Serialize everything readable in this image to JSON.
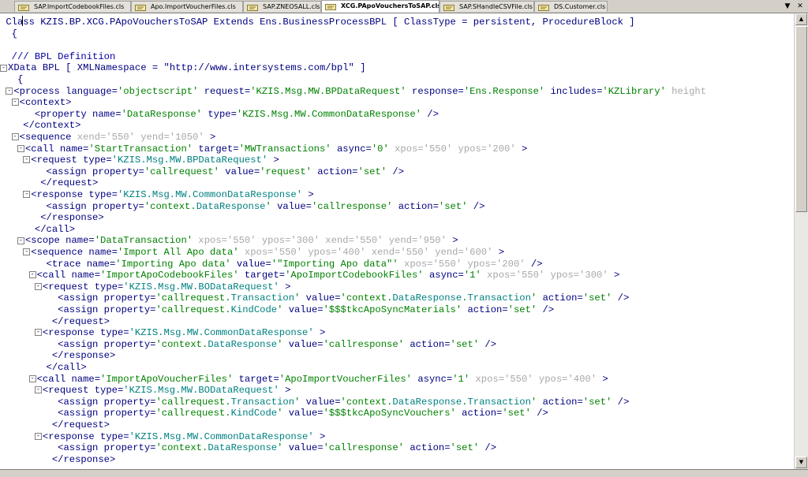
{
  "tabs": [
    {
      "label": "SAP.ImportCodebookFiles.cls",
      "active": false
    },
    {
      "label": "Apo.ImportVoucherFiles.cls",
      "active": false
    },
    {
      "label": "SAP.ZNEOSALL.cls",
      "active": false
    },
    {
      "label": "XCG.PApoVouchersToSAP.cls",
      "active": true
    },
    {
      "label": "SAP.SHandleCSVFile.cls",
      "active": false
    },
    {
      "label": "DS.Customer.cls",
      "active": false
    }
  ],
  "tab_controls": {
    "menu_icon": "chevron-down-icon",
    "close_icon": "close-icon"
  },
  "colors": {
    "tag": "#000080",
    "string": "#008000",
    "ident": "#0000a0",
    "grey_attr": "#a8a8a8",
    "class_ref": "#008080"
  },
  "code_lines": [
    {
      "fold": "",
      "indent": "",
      "tokens": [
        [
          "k",
          "Class "
        ],
        [
          "p",
          "KZIS.BP.XCG.PApoVouchersToSAP "
        ],
        [
          "k",
          "Extends "
        ],
        [
          "p",
          "Ens.BusinessProcessBPL "
        ],
        [
          "k",
          "[ "
        ],
        [
          "p",
          "ClassType "
        ],
        [
          "k",
          "= "
        ],
        [
          "p",
          "persistent, ProcedureBlock "
        ],
        [
          "k",
          "]"
        ]
      ]
    },
    {
      "fold": "",
      "indent": " ",
      "tokens": [
        [
          "k",
          "{"
        ]
      ]
    },
    {
      "fold": "",
      "indent": "",
      "tokens": []
    },
    {
      "fold": "",
      "indent": " ",
      "tokens": [
        [
          "b",
          "/// BPL Definition"
        ]
      ]
    },
    {
      "fold": "-",
      "indent": "",
      "tokens": [
        [
          "k",
          "XData "
        ],
        [
          "p",
          "BPL "
        ],
        [
          "k",
          "[ "
        ],
        [
          "p",
          "XMLNamespace "
        ],
        [
          "k",
          "= "
        ],
        [
          "p",
          "\"http://www.intersystems.com/bpl\" "
        ],
        [
          "k",
          "]"
        ]
      ]
    },
    {
      "fold": "",
      "indent": "  ",
      "tokens": [
        [
          "k",
          "{"
        ]
      ]
    },
    {
      "fold": "-",
      "indent": " ",
      "tokens": [
        [
          "p",
          "<process "
        ],
        [
          "p",
          "language="
        ],
        [
          "s",
          "'objectscript' "
        ],
        [
          "p",
          "request="
        ],
        [
          "s",
          "'KZIS.Msg.MW.BPDataRequest' "
        ],
        [
          "p",
          "response="
        ],
        [
          "s",
          "'Ens.Response' "
        ],
        [
          "p",
          "includes="
        ],
        [
          "s",
          "'KZLibrary' "
        ],
        [
          "g",
          "height"
        ]
      ]
    },
    {
      "fold": "-",
      "indent": "  ",
      "tokens": [
        [
          "p",
          "<context>"
        ]
      ]
    },
    {
      "fold": "",
      "indent": "     ",
      "tokens": [
        [
          "p",
          "<property "
        ],
        [
          "p",
          "name="
        ],
        [
          "s",
          "'DataResponse' "
        ],
        [
          "p",
          "type="
        ],
        [
          "s",
          "'KZIS.Msg.MW.CommonDataResponse' "
        ],
        [
          "p",
          "/>"
        ]
      ]
    },
    {
      "fold": "",
      "indent": "   ",
      "tokens": [
        [
          "p",
          "</context>"
        ]
      ]
    },
    {
      "fold": "-",
      "indent": "  ",
      "tokens": [
        [
          "p",
          "<sequence "
        ],
        [
          "g",
          "xend='550' yend='1050' "
        ],
        [
          "p",
          ">"
        ]
      ]
    },
    {
      "fold": "-",
      "indent": "   ",
      "tokens": [
        [
          "p",
          "<call "
        ],
        [
          "p",
          "name="
        ],
        [
          "s",
          "'StartTransaction' "
        ],
        [
          "p",
          "target="
        ],
        [
          "s",
          "'MWTransactions' "
        ],
        [
          "p",
          "async="
        ],
        [
          "s",
          "'0' "
        ],
        [
          "g",
          "xpos='550' ypos='200' "
        ],
        [
          "p",
          ">"
        ]
      ]
    },
    {
      "fold": "-",
      "indent": "    ",
      "tokens": [
        [
          "p",
          "<request "
        ],
        [
          "p",
          "type="
        ],
        [
          "c",
          "'KZIS.Msg.MW.BPDataRequest' "
        ],
        [
          "p",
          ">"
        ]
      ]
    },
    {
      "fold": "",
      "indent": "       ",
      "tokens": [
        [
          "p",
          "<assign "
        ],
        [
          "p",
          "property="
        ],
        [
          "s",
          "'callrequest' "
        ],
        [
          "p",
          "value="
        ],
        [
          "s",
          "'request' "
        ],
        [
          "p",
          "action="
        ],
        [
          "s",
          "'set' "
        ],
        [
          "p",
          "/>"
        ]
      ]
    },
    {
      "fold": "",
      "indent": "      ",
      "tokens": [
        [
          "p",
          "</request>"
        ]
      ]
    },
    {
      "fold": "-",
      "indent": "    ",
      "tokens": [
        [
          "p",
          "<response "
        ],
        [
          "p",
          "type="
        ],
        [
          "c",
          "'KZIS.Msg.MW.CommonDataResponse' "
        ],
        [
          "p",
          ">"
        ]
      ]
    },
    {
      "fold": "",
      "indent": "       ",
      "tokens": [
        [
          "p",
          "<assign "
        ],
        [
          "p",
          "property="
        ],
        [
          "s",
          "'context."
        ],
        [
          "c",
          "DataResponse"
        ],
        [
          "s",
          "' "
        ],
        [
          "p",
          "value="
        ],
        [
          "s",
          "'callresponse' "
        ],
        [
          "p",
          "action="
        ],
        [
          "s",
          "'set' "
        ],
        [
          "p",
          "/>"
        ]
      ]
    },
    {
      "fold": "",
      "indent": "      ",
      "tokens": [
        [
          "p",
          "</response>"
        ]
      ]
    },
    {
      "fold": "",
      "indent": "     ",
      "tokens": [
        [
          "p",
          "</call>"
        ]
      ]
    },
    {
      "fold": "-",
      "indent": "   ",
      "tokens": [
        [
          "p",
          "<scope "
        ],
        [
          "p",
          "name="
        ],
        [
          "s",
          "'DataTransaction' "
        ],
        [
          "g",
          "xpos='550' ypos='300' xend='550' yend='950' "
        ],
        [
          "p",
          ">"
        ]
      ]
    },
    {
      "fold": "-",
      "indent": "    ",
      "tokens": [
        [
          "p",
          "<sequence "
        ],
        [
          "p",
          "name="
        ],
        [
          "s",
          "'Import All Apo data' "
        ],
        [
          "g",
          "xpos='550' ypos='400' xend='550' yend='600' "
        ],
        [
          "p",
          ">"
        ]
      ]
    },
    {
      "fold": "",
      "indent": "       ",
      "tokens": [
        [
          "p",
          "<trace "
        ],
        [
          "p",
          "name="
        ],
        [
          "s",
          "'Importing Apo data' "
        ],
        [
          "p",
          "value="
        ],
        [
          "s",
          "'\"Importing Apo data\"' "
        ],
        [
          "g",
          "xpos='550' ypos='200' "
        ],
        [
          "p",
          "/>"
        ]
      ]
    },
    {
      "fold": "-",
      "indent": "     ",
      "tokens": [
        [
          "p",
          "<call "
        ],
        [
          "p",
          "name="
        ],
        [
          "s",
          "'ImportApoCodebookFiles' "
        ],
        [
          "p",
          "target="
        ],
        [
          "s",
          "'ApoImportCodebookFiles' "
        ],
        [
          "p",
          "async="
        ],
        [
          "s",
          "'1' "
        ],
        [
          "g",
          "xpos='550' ypos='300' "
        ],
        [
          "p",
          ">"
        ]
      ]
    },
    {
      "fold": "-",
      "indent": "      ",
      "tokens": [
        [
          "p",
          "<request "
        ],
        [
          "p",
          "type="
        ],
        [
          "c",
          "'KZIS.Msg.MW.BODataRequest' "
        ],
        [
          "p",
          ">"
        ]
      ]
    },
    {
      "fold": "",
      "indent": "         ",
      "tokens": [
        [
          "p",
          "<assign "
        ],
        [
          "p",
          "property="
        ],
        [
          "s",
          "'callrequest."
        ],
        [
          "c",
          "Transaction"
        ],
        [
          "s",
          "' "
        ],
        [
          "p",
          "value="
        ],
        [
          "s",
          "'context."
        ],
        [
          "c",
          "DataResponse"
        ],
        [
          "s",
          "."
        ],
        [
          "c",
          "Transaction"
        ],
        [
          "s",
          "' "
        ],
        [
          "p",
          "action="
        ],
        [
          "s",
          "'set' "
        ],
        [
          "p",
          "/>"
        ]
      ]
    },
    {
      "fold": "",
      "indent": "         ",
      "tokens": [
        [
          "p",
          "<assign "
        ],
        [
          "p",
          "property="
        ],
        [
          "s",
          "'callrequest."
        ],
        [
          "c",
          "KindCode"
        ],
        [
          "s",
          "' "
        ],
        [
          "p",
          "value="
        ],
        [
          "s",
          "'$$$tkcApoSyncMaterials' "
        ],
        [
          "p",
          "action="
        ],
        [
          "s",
          "'set' "
        ],
        [
          "p",
          "/>"
        ]
      ]
    },
    {
      "fold": "",
      "indent": "        ",
      "tokens": [
        [
          "p",
          "</request>"
        ]
      ]
    },
    {
      "fold": "-",
      "indent": "      ",
      "tokens": [
        [
          "p",
          "<response "
        ],
        [
          "p",
          "type="
        ],
        [
          "c",
          "'KZIS.Msg.MW.CommonDataResponse' "
        ],
        [
          "p",
          ">"
        ]
      ]
    },
    {
      "fold": "",
      "indent": "         ",
      "tokens": [
        [
          "p",
          "<assign "
        ],
        [
          "p",
          "property="
        ],
        [
          "s",
          "'context."
        ],
        [
          "c",
          "DataResponse"
        ],
        [
          "s",
          "' "
        ],
        [
          "p",
          "value="
        ],
        [
          "s",
          "'callresponse' "
        ],
        [
          "p",
          "action="
        ],
        [
          "s",
          "'set' "
        ],
        [
          "p",
          "/>"
        ]
      ]
    },
    {
      "fold": "",
      "indent": "        ",
      "tokens": [
        [
          "p",
          "</response>"
        ]
      ]
    },
    {
      "fold": "",
      "indent": "       ",
      "tokens": [
        [
          "p",
          "</call>"
        ]
      ]
    },
    {
      "fold": "-",
      "indent": "     ",
      "tokens": [
        [
          "p",
          "<call "
        ],
        [
          "p",
          "name="
        ],
        [
          "s",
          "'ImportApoVoucherFiles' "
        ],
        [
          "p",
          "target="
        ],
        [
          "s",
          "'ApoImportVoucherFiles' "
        ],
        [
          "p",
          "async="
        ],
        [
          "s",
          "'1' "
        ],
        [
          "g",
          "xpos='550' ypos='400' "
        ],
        [
          "p",
          ">"
        ]
      ]
    },
    {
      "fold": "-",
      "indent": "      ",
      "tokens": [
        [
          "p",
          "<request "
        ],
        [
          "p",
          "type="
        ],
        [
          "c",
          "'KZIS.Msg.MW.BODataRequest' "
        ],
        [
          "p",
          ">"
        ]
      ]
    },
    {
      "fold": "",
      "indent": "         ",
      "tokens": [
        [
          "p",
          "<assign "
        ],
        [
          "p",
          "property="
        ],
        [
          "s",
          "'callrequest."
        ],
        [
          "c",
          "Transaction"
        ],
        [
          "s",
          "' "
        ],
        [
          "p",
          "value="
        ],
        [
          "s",
          "'context."
        ],
        [
          "c",
          "DataResponse"
        ],
        [
          "s",
          "."
        ],
        [
          "c",
          "Transaction"
        ],
        [
          "s",
          "' "
        ],
        [
          "p",
          "action="
        ],
        [
          "s",
          "'set' "
        ],
        [
          "p",
          "/>"
        ]
      ]
    },
    {
      "fold": "",
      "indent": "         ",
      "tokens": [
        [
          "p",
          "<assign "
        ],
        [
          "p",
          "property="
        ],
        [
          "s",
          "'callrequest."
        ],
        [
          "c",
          "KindCode"
        ],
        [
          "s",
          "' "
        ],
        [
          "p",
          "value="
        ],
        [
          "s",
          "'$$$tkcApoSyncVouchers' "
        ],
        [
          "p",
          "action="
        ],
        [
          "s",
          "'set' "
        ],
        [
          "p",
          "/>"
        ]
      ]
    },
    {
      "fold": "",
      "indent": "        ",
      "tokens": [
        [
          "p",
          "</request>"
        ]
      ]
    },
    {
      "fold": "-",
      "indent": "      ",
      "tokens": [
        [
          "p",
          "<response "
        ],
        [
          "p",
          "type="
        ],
        [
          "c",
          "'KZIS.Msg.MW.CommonDataResponse' "
        ],
        [
          "p",
          ">"
        ]
      ]
    },
    {
      "fold": "",
      "indent": "         ",
      "tokens": [
        [
          "p",
          "<assign "
        ],
        [
          "p",
          "property="
        ],
        [
          "s",
          "'context."
        ],
        [
          "c",
          "DataResponse"
        ],
        [
          "s",
          "' "
        ],
        [
          "p",
          "value="
        ],
        [
          "s",
          "'callresponse' "
        ],
        [
          "p",
          "action="
        ],
        [
          "s",
          "'set' "
        ],
        [
          "p",
          "/>"
        ]
      ]
    },
    {
      "fold": "",
      "indent": "        ",
      "tokens": [
        [
          "p",
          "</response>"
        ]
      ]
    }
  ]
}
